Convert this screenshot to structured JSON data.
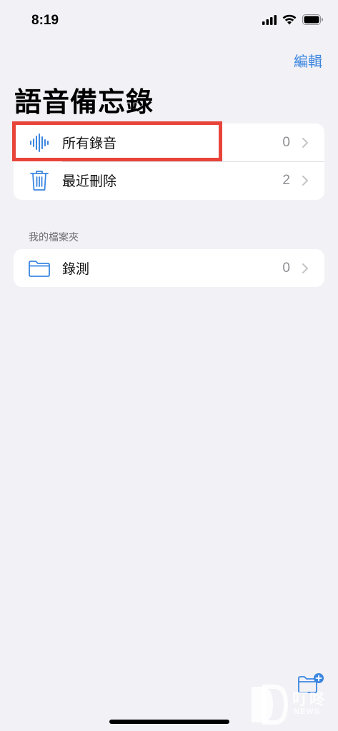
{
  "status_bar": {
    "time": "8:19"
  },
  "header": {
    "edit_label": "編輯",
    "title": "語音備忘錄"
  },
  "main_list": [
    {
      "label": "所有錄音",
      "count": "0",
      "icon": "waveform-icon"
    },
    {
      "label": "最近刪除",
      "count": "2",
      "icon": "trash-icon"
    }
  ],
  "folders_section": {
    "header": "我的檔案夾",
    "items": [
      {
        "label": "錄測",
        "count": "0",
        "icon": "folder-icon"
      }
    ]
  },
  "toolbar": {
    "new_folder_icon": "new-folder-icon"
  },
  "watermark": {
    "text": "叮咚",
    "sub": "NEWS"
  },
  "colors": {
    "accent": "#3b86e0",
    "background": "#f2f1f6",
    "highlight": "#e8443a"
  }
}
